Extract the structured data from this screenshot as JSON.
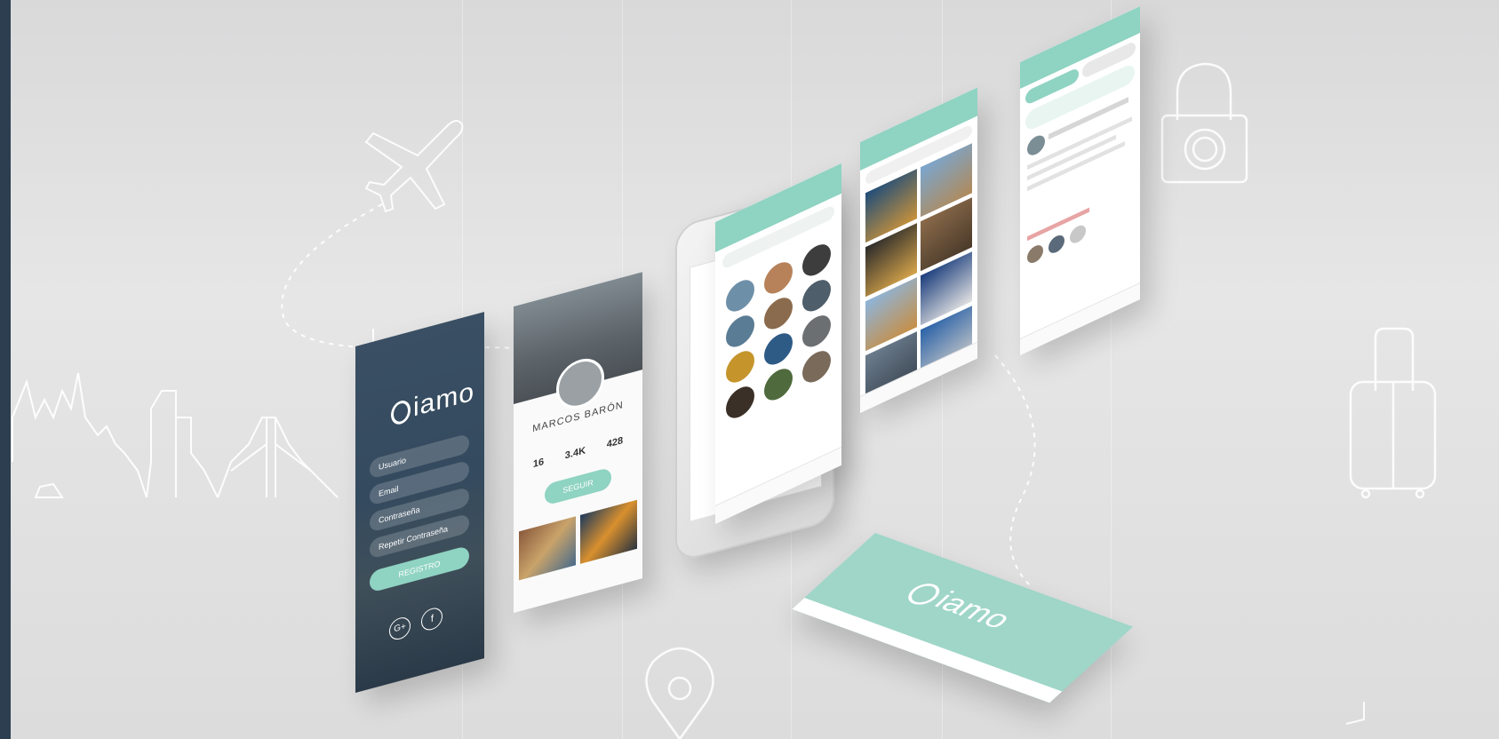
{
  "brand": {
    "logo_text": "iamo",
    "accent": "#8fd3c2",
    "dark": "#2f4356"
  },
  "login": {
    "fields": [
      "Usuario",
      "Email",
      "Contraseña",
      "Repetir Contraseña"
    ],
    "register_label": "REGISTRO",
    "social": [
      "G+",
      "f"
    ]
  },
  "profile": {
    "name": "MARCOS BARÓN",
    "stats": [
      "16",
      "3.4K",
      "428"
    ],
    "button_label": "SEGUIR"
  }
}
